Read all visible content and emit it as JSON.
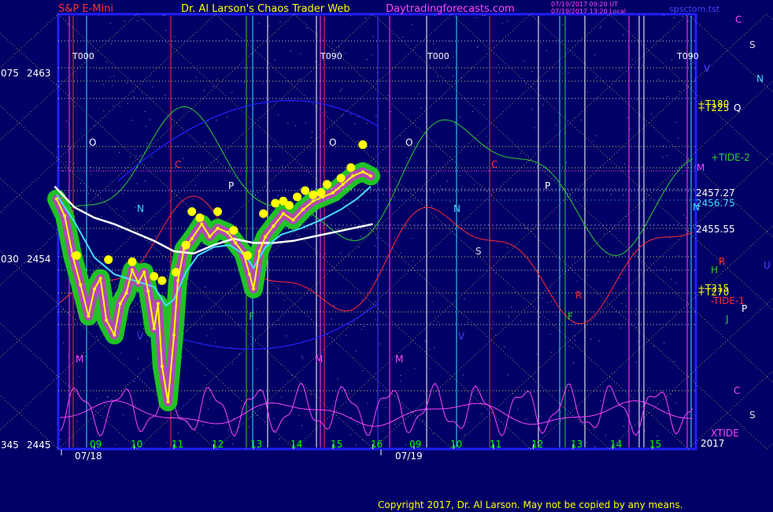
{
  "header": {
    "instrument": "S&P E-Mini",
    "title": "Dr. Al Larson's Chaos Trader Web",
    "site": "Daytradingforecasts.com",
    "stamp1": "07/19/2017 09:20 UT",
    "stamp2": "07/19/2017 13:20 Local",
    "file": "spsctom.tst"
  },
  "colors": {
    "background": "#000066",
    "frame": "#2020ff",
    "price": "#ffff00",
    "avg_white": "#ffffff",
    "avg_cyan": "#44ddff",
    "glow": "#22cc22",
    "dots": "#ffff00",
    "magenta": "#ff44ff",
    "red": "#ff3030",
    "green": "#33cc33"
  },
  "copyright": "Copyright 2017, Dr. Al Larson. May not be copied by any means.",
  "chart_data": {
    "type": "line",
    "y_axis": {
      "range": [
        2445,
        2465
      ],
      "ticks": [
        {
          "deg": "075",
          "price": "2463",
          "value": 2463
        },
        {
          "deg": "030",
          "price": "2454",
          "value": 2454
        },
        {
          "deg": "345",
          "price": "2445",
          "value": 2445
        }
      ]
    },
    "x_axis": {
      "range": [
        8,
        17.4
      ],
      "hour_labels": [
        {
          "t": 9,
          "label": "09"
        },
        {
          "t": 10,
          "label": "10"
        },
        {
          "t": 11,
          "label": "11"
        },
        {
          "t": 12,
          "label": "12"
        },
        {
          "t": 13,
          "label": "13"
        },
        {
          "t": 14,
          "label": "14"
        },
        {
          "t": 15,
          "label": "15"
        },
        {
          "t": 16,
          "label": "16"
        },
        {
          "t": 9,
          "label": "09",
          "day": 2
        },
        {
          "t": 10,
          "label": "10",
          "day": 2
        },
        {
          "t": 11,
          "label": "11",
          "day": 2
        },
        {
          "t": 12,
          "label": "12",
          "day": 2
        },
        {
          "t": 13,
          "label": "13",
          "day": 2
        },
        {
          "t": 14,
          "label": "14",
          "day": 2
        },
        {
          "t": 15,
          "label": "15",
          "day": 2
        }
      ],
      "dates": [
        "07/18",
        "07/19"
      ],
      "year": "2017"
    },
    "price_levels": [
      {
        "label": "2457.27",
        "value": 2457.27,
        "color": "#ffffff"
      },
      {
        "label": "2456.75",
        "value": 2456.75,
        "color": "#44ddff"
      },
      {
        "label": "2455.55",
        "value": 2455.55,
        "color": "#ffffff"
      }
    ],
    "time_markers": [
      "T000",
      "T090",
      "T000",
      "T090"
    ],
    "right_labels": [
      {
        "text": "C",
        "color": "#ff44ff"
      },
      {
        "text": "S",
        "color": "#dddddd"
      },
      {
        "text": "V",
        "color": "#4444ff"
      },
      {
        "text": "N",
        "color": "#44ddff"
      },
      {
        "text": "+T180",
        "color": "#ffff00"
      },
      {
        "text": "+T225",
        "color": "#ffff00"
      },
      {
        "text": "Q",
        "color": "#ffffff"
      },
      {
        "text": "+TIDE-2",
        "color": "#33cc33"
      },
      {
        "text": "M",
        "color": "#ff44ff"
      },
      {
        "text": "N",
        "color": "#44ddff"
      },
      {
        "text": "R",
        "color": "#ff3030"
      },
      {
        "text": "U",
        "color": "#4444ff"
      },
      {
        "text": "H",
        "color": "#33cc33"
      },
      {
        "text": "+T315",
        "color": "#ffff00"
      },
      {
        "text": "+T270",
        "color": "#ffff00"
      },
      {
        "text": "-TIDE-1",
        "color": "#ff3030"
      },
      {
        "text": "P",
        "color": "#ffffff"
      },
      {
        "text": "J",
        "color": "#33cc33"
      },
      {
        "text": "C",
        "color": "#ff44ff"
      },
      {
        "text": "S",
        "color": "#dddddd"
      },
      {
        "text": "XTIDE",
        "color": "#ff44ff"
      }
    ],
    "planet_labels": [
      "O",
      "C",
      "N",
      "P",
      "M",
      "F",
      "V",
      "O",
      "C",
      "P",
      "N",
      "S",
      "M",
      "F",
      "V",
      "O",
      "M",
      "R"
    ],
    "series": [
      {
        "name": "",
        "values": [
          [
            8.05,
            2456.8
          ],
          [
            8.25,
            2456.0
          ],
          [
            8.45,
            2454.1
          ],
          [
            8.65,
            2452.7
          ],
          [
            8.85,
            2451.2
          ],
          [
            9.0,
            2452.5
          ],
          [
            9.15,
            2453.0
          ],
          [
            9.3,
            2451.0
          ],
          [
            9.5,
            2450.3
          ],
          [
            9.65,
            2451.8
          ],
          [
            9.8,
            2452.3
          ],
          [
            9.95,
            2453.4
          ],
          [
            10.1,
            2452.8
          ],
          [
            10.25,
            2453.3
          ],
          [
            10.35,
            2452.4
          ],
          [
            10.5,
            2450.6
          ],
          [
            10.6,
            2451.8
          ],
          [
            10.7,
            2448.8
          ],
          [
            10.85,
            2447.1
          ],
          [
            11.0,
            2450.3
          ],
          [
            11.1,
            2452.9
          ],
          [
            11.25,
            2454.4
          ],
          [
            11.45,
            2454.9
          ],
          [
            11.7,
            2455.6
          ],
          [
            11.9,
            2455.0
          ],
          [
            12.1,
            2455.4
          ],
          [
            12.35,
            2455.2
          ],
          [
            12.55,
            2454.7
          ],
          [
            12.75,
            2454.2
          ],
          [
            12.9,
            2453.2
          ],
          [
            13.0,
            2452.5
          ],
          [
            13.15,
            2454.3
          ],
          [
            13.3,
            2455.0
          ],
          [
            13.5,
            2455.5
          ],
          [
            13.75,
            2456.1
          ],
          [
            14.0,
            2455.8
          ],
          [
            14.25,
            2456.3
          ],
          [
            14.5,
            2456.7
          ],
          [
            14.75,
            2456.9
          ],
          [
            15.0,
            2457.1
          ],
          [
            15.25,
            2457.5
          ],
          [
            15.5,
            2457.9
          ],
          [
            15.75,
            2458.1
          ],
          [
            15.95,
            2457.9
          ]
        ]
      },
      {
        "name": "",
        "values": [
          [
            8.0,
            2457.4
          ],
          [
            8.5,
            2456.4
          ],
          [
            9.0,
            2455.9
          ],
          [
            9.5,
            2455.6
          ],
          [
            10.0,
            2455.2
          ],
          [
            10.5,
            2454.8
          ],
          [
            11.0,
            2454.3
          ],
          [
            11.5,
            2454.2
          ],
          [
            12.0,
            2454.6
          ],
          [
            12.5,
            2454.9
          ],
          [
            13.0,
            2454.7
          ],
          [
            13.5,
            2454.7
          ],
          [
            14.0,
            2454.8
          ],
          [
            14.5,
            2455.0
          ],
          [
            15.0,
            2455.2
          ],
          [
            15.5,
            2455.4
          ],
          [
            16.0,
            2455.6
          ]
        ]
      },
      {
        "name": "",
        "values": [
          [
            8.05,
            2457.0
          ],
          [
            8.5,
            2455.7
          ],
          [
            9.0,
            2454.0
          ],
          [
            9.5,
            2453.2
          ],
          [
            10.0,
            2452.9
          ],
          [
            10.5,
            2452.6
          ],
          [
            10.8,
            2451.7
          ],
          [
            11.0,
            2452.0
          ],
          [
            11.3,
            2453.3
          ],
          [
            11.6,
            2454.1
          ],
          [
            12.0,
            2454.5
          ],
          [
            12.4,
            2454.6
          ],
          [
            12.8,
            2454.1
          ],
          [
            13.0,
            2453.5
          ],
          [
            13.3,
            2454.5
          ],
          [
            13.7,
            2455.1
          ],
          [
            14.2,
            2455.4
          ],
          [
            14.7,
            2455.8
          ],
          [
            15.2,
            2456.3
          ],
          [
            15.6,
            2456.8
          ],
          [
            15.95,
            2457.4
          ]
        ]
      }
    ],
    "highlight_points": [
      [
        8.55,
        2454.1
      ],
      [
        9.35,
        2453.9
      ],
      [
        9.95,
        2453.8
      ],
      [
        10.5,
        2453.1
      ],
      [
        10.7,
        2452.9
      ],
      [
        11.05,
        2453.3
      ],
      [
        11.3,
        2454.6
      ],
      [
        11.45,
        2456.2
      ],
      [
        11.65,
        2455.9
      ],
      [
        12.1,
        2456.2
      ],
      [
        12.5,
        2455.3
      ],
      [
        12.85,
        2454.1
      ],
      [
        13.25,
        2456.1
      ],
      [
        13.55,
        2456.6
      ],
      [
        13.75,
        2456.7
      ],
      [
        13.9,
        2456.5
      ],
      [
        14.1,
        2456.9
      ],
      [
        14.3,
        2457.2
      ],
      [
        14.5,
        2457.0
      ],
      [
        14.7,
        2457.1
      ],
      [
        14.85,
        2457.5
      ],
      [
        15.2,
        2457.8
      ],
      [
        15.45,
        2458.3
      ],
      [
        15.75,
        2459.4
      ]
    ],
    "grid": true
  }
}
